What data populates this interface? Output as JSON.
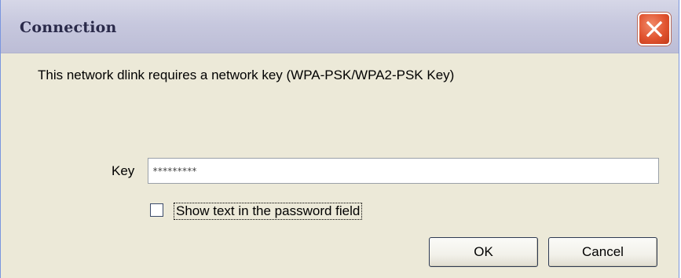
{
  "window": {
    "title": "Connection"
  },
  "message": "This network dlink requires a network key (WPA-PSK/WPA2-PSK Key)",
  "key": {
    "label": "Key",
    "value": "*********"
  },
  "show_text": {
    "label": "Show text in the password field",
    "checked": false
  },
  "buttons": {
    "ok": "OK",
    "cancel": "Cancel"
  },
  "icons": {
    "close": "close-icon"
  },
  "colors": {
    "close_button": "#e1532f",
    "titlebar": "#c7c8de",
    "dialog_background": "#ece9d8"
  }
}
